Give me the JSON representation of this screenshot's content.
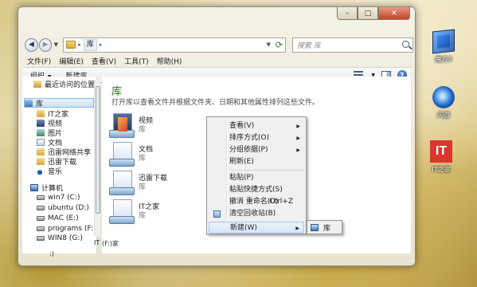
{
  "window": {
    "address": {
      "crumb": "库",
      "separator": "▸"
    },
    "search_placeholder": "搜索 库"
  },
  "menubar": [
    "文件(F)",
    "编辑(E)",
    "查看(V)",
    "工具(T)",
    "帮助(H)"
  ],
  "toolbar": {
    "organize": "组织",
    "new_library": "新建库"
  },
  "sidebar": {
    "recent": "最近访问的位置",
    "library": "库",
    "lib_items": [
      "IT之家",
      "视频",
      "图片",
      "文档",
      "迅雷网络共享",
      "迅雷下载",
      "音乐"
    ],
    "computer": "计算机",
    "drives": [
      "win7 (C:)",
      "ubuntu (D:)",
      "MAC (E:)",
      "programs (F:)",
      "WIN8 (G:)"
    ]
  },
  "main": {
    "title": "库",
    "description": "打开库以查看文件并根据文件夹、日期和其他属性排列这些文件。",
    "items": [
      {
        "name": "视频",
        "sub": "库"
      },
      {
        "name": "文档",
        "sub": "库"
      },
      {
        "name": "迅雷下载",
        "sub": "库"
      },
      {
        "name": "IT之家",
        "sub": "库"
      }
    ]
  },
  "context_menu": {
    "view": "查看(V)",
    "sort": "排序方式(O)",
    "group": "分组依据(P)",
    "refresh": "刷新(E)",
    "paste": "粘贴(P)",
    "paste_shortcut": "粘贴快捷方式(S)",
    "undo": "撤消 重命名(U)",
    "undo_shortcut": "Ctrl+Z",
    "empty_bin": "清空回收站(B)",
    "new": "新建(W)",
    "submenu_library": "库"
  },
  "desktop": {
    "mofang": "魔方3",
    "shanyou": "闪游",
    "ithome": "IT之家",
    "ithome_glyph": "IT"
  },
  "stray": {
    "it_label": "IT",
    "f_drive": "(F:)家",
    "paren": ":)"
  }
}
